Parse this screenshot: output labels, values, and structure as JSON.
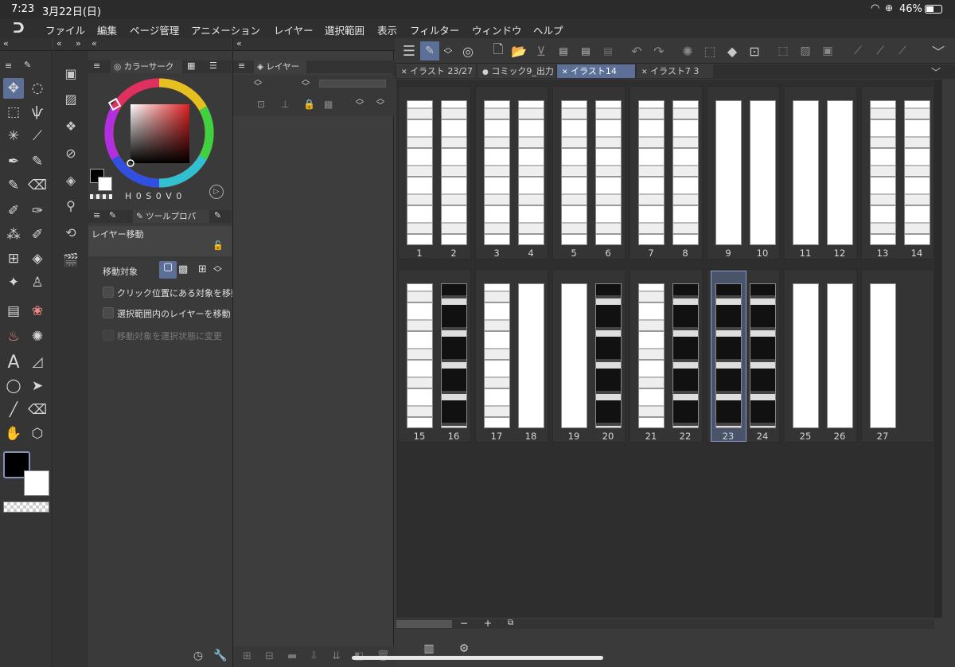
{
  "status": {
    "time": "7:23",
    "date": "3月22日(日)",
    "battery": "46%"
  },
  "menu": [
    "ファイル",
    "編集",
    "ページ管理",
    "アニメーション",
    "レイヤー",
    "選択範囲",
    "表示",
    "フィルター",
    "ウィンドウ",
    "ヘルプ"
  ],
  "color_panel": {
    "tab": "カラーサーク",
    "hsv": [
      "H",
      "0",
      "S",
      "0",
      "V",
      "0"
    ]
  },
  "layer_panel": {
    "tab": "レイヤー"
  },
  "tool_property": {
    "tab": "ツールプロパ",
    "title": "レイヤー移動",
    "target_label": "移動対象",
    "options": [
      "クリック位置にある対象を移動",
      "選択範囲内のレイヤーを移動",
      "移動対象を選択状態に変更"
    ]
  },
  "doc_tabs": [
    "イラスト 23/27",
    "コミック9_出力",
    "イラスト14",
    "イラスト7 3"
  ],
  "pages": [
    "1",
    "2",
    "3",
    "4",
    "5",
    "6",
    "7",
    "8",
    "9",
    "10",
    "11",
    "12",
    "13",
    "14",
    "15",
    "16",
    "17",
    "18",
    "19",
    "20",
    "21",
    "22",
    "23",
    "24",
    "25",
    "26",
    "27"
  ],
  "selected_page": "23",
  "zoom_controls": {
    "minus": "−",
    "plus": "+"
  },
  "colors": {
    "accent": "#5b6f97",
    "bg": "#3c3c3c"
  }
}
